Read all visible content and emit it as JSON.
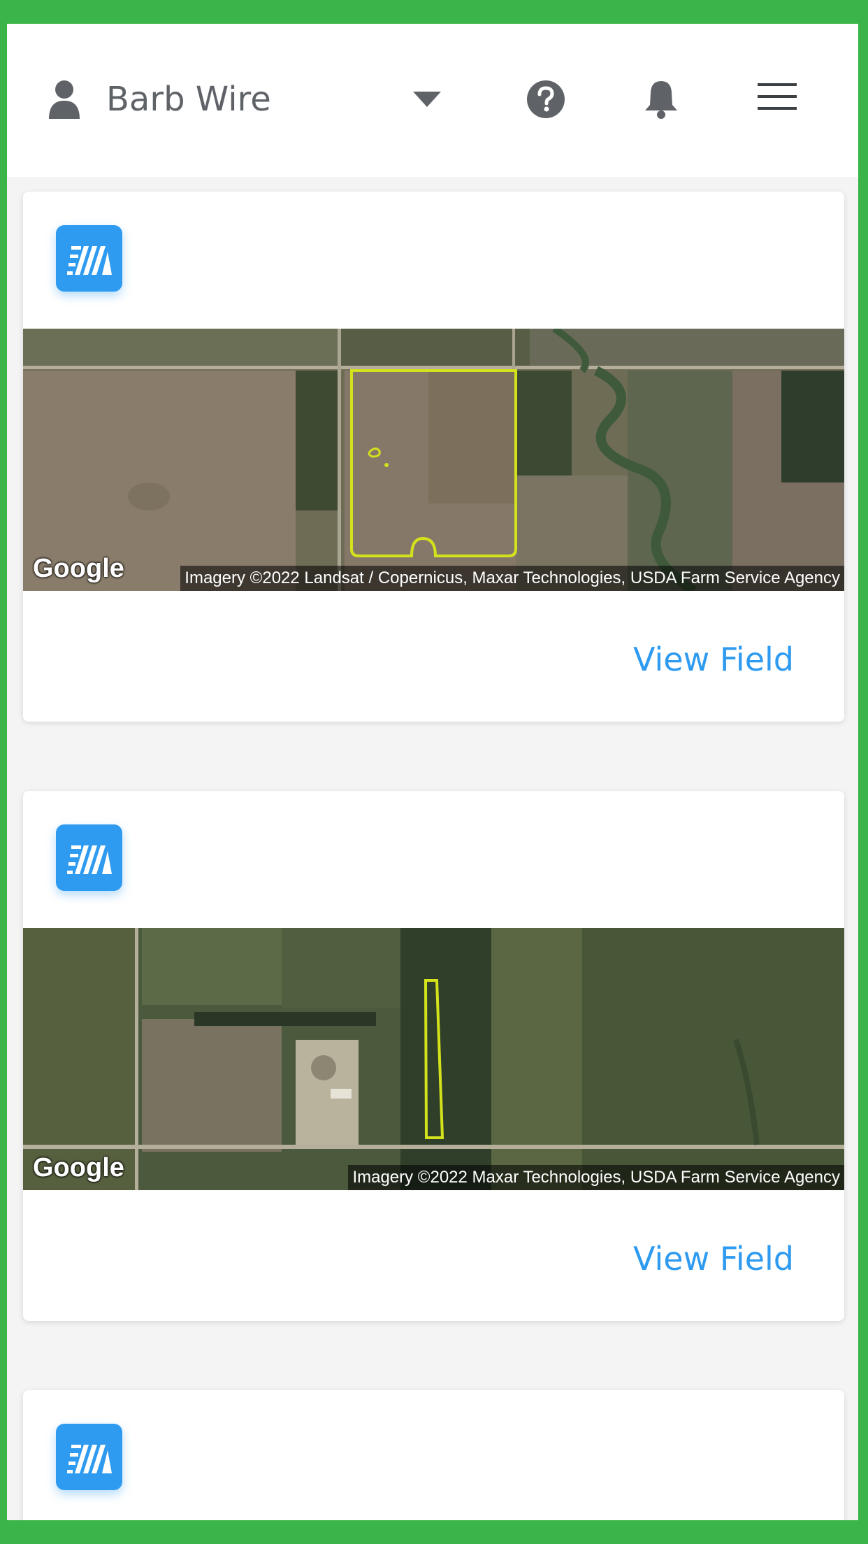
{
  "header": {
    "user_icon": "user-icon",
    "user_name": "Barb Wire",
    "dropdown_icon": "caret-down-icon",
    "help_icon": "question-circle-icon",
    "notification_icon": "bell-icon",
    "menu_icon": "hamburger-menu-icon"
  },
  "colors": {
    "frame_border": "#3bb54a",
    "accent": "#2e9bf0",
    "field_outline": "#d4e21c"
  },
  "fields": [
    {
      "logo_icon": "app-logo-icon",
      "map_provider": "Google",
      "attribution": "Imagery ©2022 Landsat / Copernicus, Maxar Technologies, USDA Farm Service Agency",
      "action_label": "View Field"
    },
    {
      "logo_icon": "app-logo-icon",
      "map_provider": "Google",
      "attribution": "Imagery ©2022 Maxar Technologies, USDA Farm Service Agency",
      "action_label": "View Field"
    },
    {
      "logo_icon": "app-logo-icon"
    }
  ]
}
